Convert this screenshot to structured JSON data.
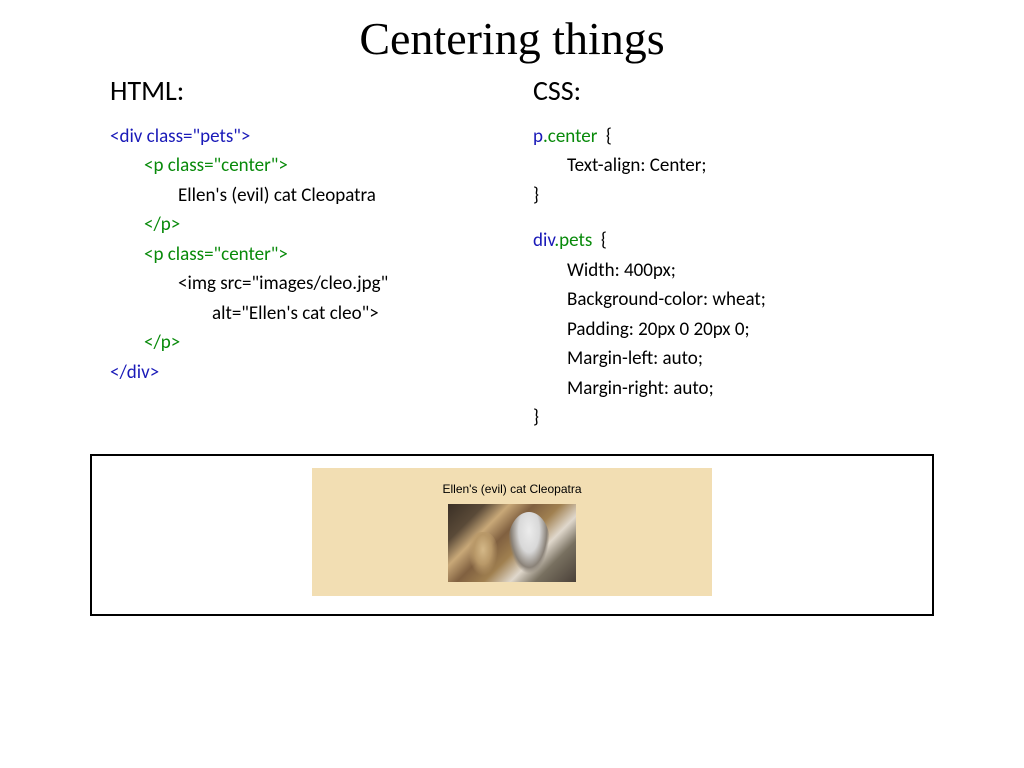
{
  "title": "Centering things",
  "left": {
    "heading": "HTML:",
    "lines": [
      {
        "cls": "tag-blue",
        "indent": 0,
        "text": "<div class=\"pets\">"
      },
      {
        "cls": "tag-green",
        "indent": 1,
        "text": "<p class=\"center\">"
      },
      {
        "cls": "plain",
        "indent": 2,
        "text": "Ellen's (evil) cat Cleopatra"
      },
      {
        "cls": "tag-green",
        "indent": 1,
        "text": "</p>"
      },
      {
        "cls": "tag-green",
        "indent": 1,
        "text": "<p class=\"center\">"
      },
      {
        "cls": "plain",
        "indent": 2,
        "text": "<img src=\"images/cleo.jpg\""
      },
      {
        "cls": "plain",
        "indent": 3,
        "text": "alt=\"Ellen's cat cleo\">"
      },
      {
        "cls": "tag-green",
        "indent": 1,
        "text": "</p>"
      },
      {
        "cls": "tag-blue",
        "indent": 0,
        "text": "</div>"
      }
    ]
  },
  "right": {
    "heading": "CSS:",
    "blocks": [
      {
        "selector_prefix": "p",
        "selector_suffix": ".center",
        "open": "  {",
        "rules": [
          "Text-align: Center;"
        ],
        "close": "}"
      },
      {
        "selector_prefix": "div",
        "selector_suffix": ".pets",
        "open": "  {",
        "rules": [
          "Width: 400px;",
          "Background-color: wheat;",
          "Padding: 20px 0 20px 0;",
          "Margin-left: auto;",
          "Margin-right: auto;"
        ],
        "close": "}"
      }
    ]
  },
  "example": {
    "caption": "Ellen's (evil) cat Cleopatra"
  }
}
